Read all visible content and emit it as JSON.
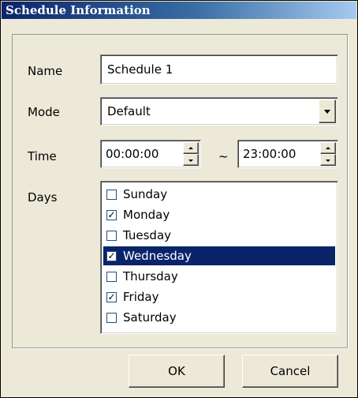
{
  "dialog": {
    "title": "Schedule Information"
  },
  "form": {
    "name_label": "Name",
    "name_value": "Schedule 1",
    "mode_label": "Mode",
    "mode_value": "Default",
    "time_label": "Time",
    "time_start": "00:00:00",
    "time_separator": "~",
    "time_end": "23:00:00",
    "days_label": "Days"
  },
  "days": [
    {
      "label": "Sunday",
      "checked": false,
      "selected": false
    },
    {
      "label": "Monday",
      "checked": true,
      "selected": false
    },
    {
      "label": "Tuesday",
      "checked": false,
      "selected": false
    },
    {
      "label": "Wednesday",
      "checked": true,
      "selected": true
    },
    {
      "label": "Thursday",
      "checked": false,
      "selected": false
    },
    {
      "label": "Friday",
      "checked": true,
      "selected": false
    },
    {
      "label": "Saturday",
      "checked": false,
      "selected": false
    }
  ],
  "buttons": {
    "ok": "OK",
    "cancel": "Cancel"
  },
  "colors": {
    "selection": "#0a246a",
    "face": "#ece9d8",
    "title_start": "#0a246a",
    "title_end": "#a6caf0"
  }
}
